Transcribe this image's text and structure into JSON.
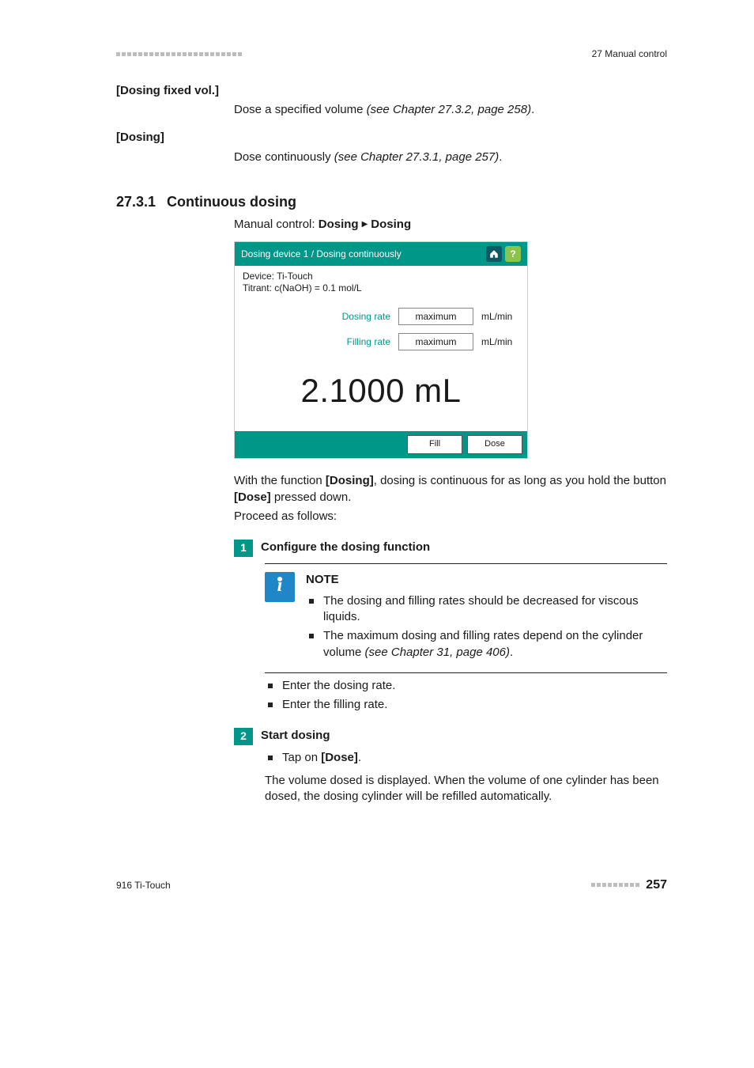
{
  "header_right": "27 Manual control",
  "def1": {
    "term": "[Dosing fixed vol.]",
    "body_a": "Dose a specified volume ",
    "body_i": "(see Chapter 27.3.2, page 258)",
    "body_b": "."
  },
  "def2": {
    "term": "[Dosing]",
    "body_a": "Dose continuously ",
    "body_i": "(see Chapter 27.3.1, page 257)",
    "body_b": "."
  },
  "h2": {
    "num": "27.3.1",
    "title": "Continuous dosing"
  },
  "breadcrumb": {
    "a": "Manual control: ",
    "b": "Dosing",
    "c": "Dosing"
  },
  "dev": {
    "title": "Dosing device 1 / Dosing continuously",
    "icon_q": "?",
    "info1": "Device: Ti-Touch",
    "info2": "Titrant: c(NaOH) = 0.1 mol/L",
    "row1_label": "Dosing rate",
    "row1_value": "maximum",
    "row1_unit": "mL/min",
    "row2_label": "Filling rate",
    "row2_value": "maximum",
    "row2_unit": "mL/min",
    "big": "2.1000 mL",
    "btn_fill": "Fill",
    "btn_dose": "Dose"
  },
  "para_after_a": "With the function ",
  "para_after_b": "[Dosing]",
  "para_after_c": ", dosing is continuous for as long as you hold the button ",
  "para_after_d": "[Dose]",
  "para_after_e": " pressed down.",
  "proceed": "Proceed as follows:",
  "step1": {
    "num": "1",
    "title": "Configure the dosing function"
  },
  "note": {
    "title": "NOTE",
    "b1": "The dosing and filling rates should be decreased for viscous liquids.",
    "b2a": "The maximum dosing and filling rates depend on the cylinder volume ",
    "b2i": "(see Chapter 31, page 406)",
    "b2b": "."
  },
  "step1outer": {
    "b1": "Enter the dosing rate.",
    "b2": "Enter the filling rate."
  },
  "step2": {
    "num": "2",
    "title": "Start dosing",
    "b1a": "Tap on ",
    "b1b": "[Dose]",
    "b1c": ".",
    "para": "The volume dosed is displayed. When the volume of one cylinder has been dosed, the dosing cylinder will be refilled automatically."
  },
  "footer_left": "916 Ti-Touch",
  "page": "257"
}
